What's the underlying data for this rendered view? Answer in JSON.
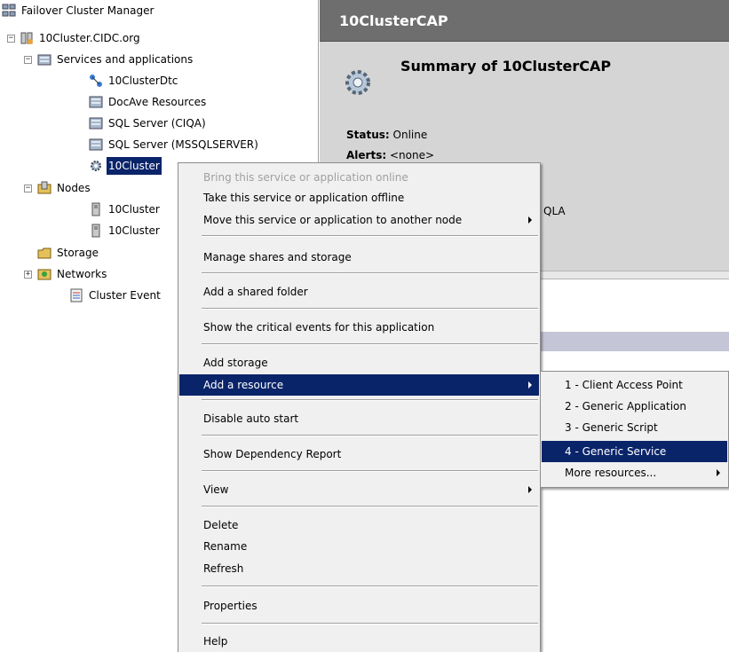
{
  "tree": {
    "root": "Failover Cluster Manager",
    "cluster": "10Cluster.CIDC.org",
    "services": "Services and applications",
    "service_items": [
      "10ClusterDtc",
      "DocAve Resources",
      "SQL Server (CIQA)",
      "SQL Server (MSSQLSERVER)",
      "10Cluster"
    ],
    "nodes": "Nodes",
    "node_items": [
      "10Cluster",
      "10Cluster"
    ],
    "storage": "Storage",
    "networks": "Networks",
    "events": "Cluster Event"
  },
  "right": {
    "header_title": "10ClusterCAP",
    "summary_title": "Summary of 10ClusterCAP",
    "status_label": "Status:",
    "status_value": "Online",
    "alerts_label": "Alerts:",
    "alerts_value": "<none>",
    "partial_text": "QLA"
  },
  "context_menu": {
    "bring_online": "Bring this service or application online",
    "take_offline": "Take this service or application offline",
    "move": "Move this service or application to another node",
    "manage_shares": "Manage shares and storage",
    "add_shared_folder": "Add a shared folder",
    "show_critical": "Show the critical events for this application",
    "add_storage": "Add storage",
    "add_resource": "Add a resource",
    "disable_auto_start": "Disable auto start",
    "show_dependency": "Show Dependency Report",
    "view": "View",
    "delete": "Delete",
    "rename": "Rename",
    "refresh": "Refresh",
    "properties": "Properties",
    "help": "Help"
  },
  "submenu": {
    "items": [
      "1 - Client Access Point",
      "2 - Generic Application",
      "3 - Generic Script",
      "4 - Generic Service",
      "More resources..."
    ]
  },
  "colors": {
    "highlight": "#0a246a",
    "menu_bg": "#f0f0f0",
    "header_bg": "#6e6e6e",
    "summary_bg": "#d5d5d5"
  }
}
